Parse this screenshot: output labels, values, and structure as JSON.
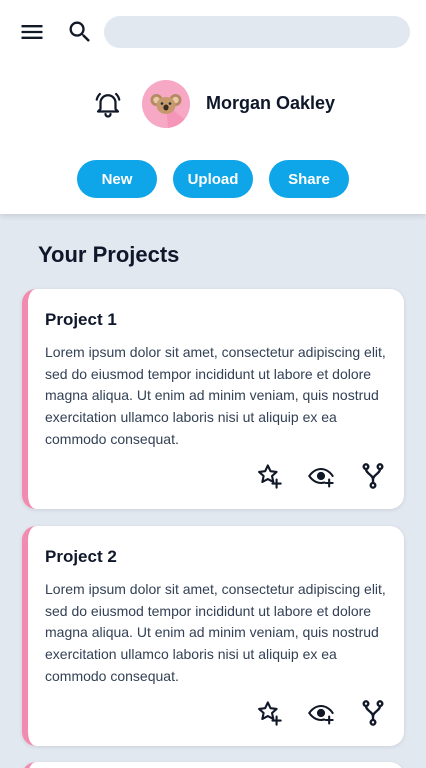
{
  "header": {
    "icons": {
      "menu": "menu-icon",
      "search": "search-icon",
      "notifications": "bell-ring-icon"
    },
    "search": {
      "value": "",
      "placeholder": ""
    },
    "user": {
      "name": "Morgan Oakley",
      "avatar": "koala-avatar"
    },
    "actions": {
      "new_label": "New",
      "upload_label": "Upload",
      "share_label": "Share"
    }
  },
  "main": {
    "section_title": "Your Projects",
    "projects": [
      {
        "title": "Project 1",
        "description": "Lorem ipsum dolor sit amet, consectetur adipiscing elit, sed do eiusmod tempor incididunt ut labore et dolore magna aliqua. Ut enim ad minim veniam, quis nostrud exercitation ullamco laboris nisi ut aliquip ex ea commodo consequat."
      },
      {
        "title": "Project 2",
        "description": "Lorem ipsum dolor sit amet, consectetur adipiscing elit, sed do eiusmod tempor incididunt ut labore et dolore magna aliqua. Ut enim ad minim veniam, quis nostrud exercitation ullamco laboris nisi ut aliquip ex ea commodo consequat."
      }
    ],
    "card_actions": {
      "star": "star-plus-icon",
      "watch": "eye-plus-icon",
      "fork": "fork-icon"
    }
  },
  "colors": {
    "accent": "#0ea5e9",
    "card_stripe": "#f38bb0",
    "page_bg": "#e2e8f0",
    "text": "#0f172a"
  }
}
